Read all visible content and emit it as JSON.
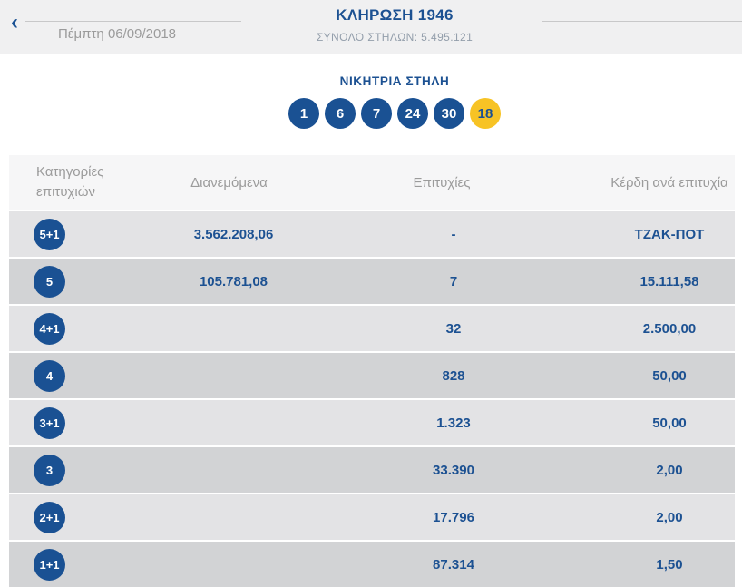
{
  "header": {
    "back_icon": "‹",
    "date": "Πέμπτη 06/09/2018",
    "title": "ΚΛΗΡΩΣΗ 1946",
    "subtitle": "ΣΥΝΟΛΟ ΣΤΗΛΩΝ: 5.495.121"
  },
  "winning_column": {
    "title": "ΝΙΚΗΤΡΙΑ ΣΤΗΛΗ",
    "numbers": [
      "1",
      "6",
      "7",
      "24",
      "30"
    ],
    "joker_number": "18"
  },
  "results_table": {
    "columns": {
      "category": "Κατηγορίες επιτυχιών",
      "distributed": "Διανεμόμενα",
      "wins": "Επιτυχίες",
      "winnings": "Κέρδη ανά επιτυχία"
    },
    "rows": [
      {
        "category": "5+1",
        "distributed": "3.562.208,06",
        "wins": "-",
        "winnings": "ΤΖΑΚ-ΠΟΤ"
      },
      {
        "category": "5",
        "distributed": "105.781,08",
        "wins": "7",
        "winnings": "15.111,58"
      },
      {
        "category": "4+1",
        "distributed": "",
        "wins": "32",
        "winnings": "2.500,00"
      },
      {
        "category": "4",
        "distributed": "",
        "wins": "828",
        "winnings": "50,00"
      },
      {
        "category": "3+1",
        "distributed": "",
        "wins": "1.323",
        "winnings": "50,00"
      },
      {
        "category": "3",
        "distributed": "",
        "wins": "33.390",
        "winnings": "2,00"
      },
      {
        "category": "2+1",
        "distributed": "",
        "wins": "17.796",
        "winnings": "2,00"
      },
      {
        "category": "1+1",
        "distributed": "",
        "wins": "87.314",
        "winnings": "1,50"
      }
    ]
  },
  "colors": {
    "primary_blue": "#1a5193",
    "joker_yellow": "#f7c325",
    "row_light": "#e3e3e5",
    "row_dark": "#d2d3d5",
    "muted_gray": "#9b9b9b"
  }
}
